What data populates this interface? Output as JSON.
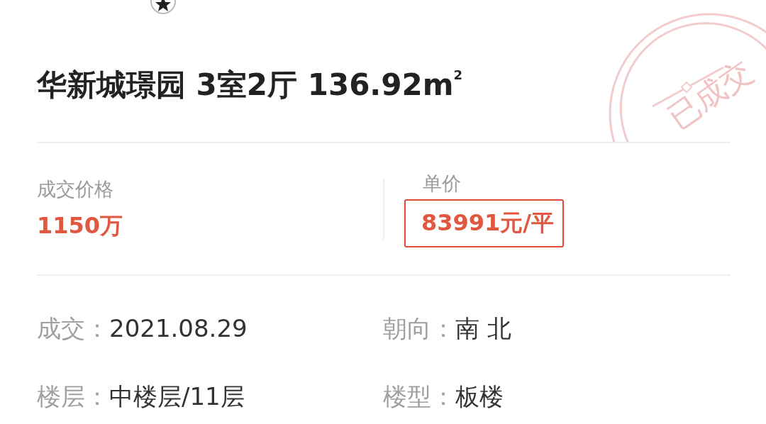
{
  "title": "华新城璟园 3室2厅 136.92m$^{2}$",
  "stamp": "已成交",
  "price": {
    "label": "成交价格",
    "value": "1150万"
  },
  "unit_price": {
    "label": "单价",
    "value": "83991元/平",
    "highlighted": true
  },
  "details": [
    {
      "label": "成交：",
      "value": "2021.08.29"
    },
    {
      "label": "朝向：",
      "value": "南 北"
    },
    {
      "label": "楼层：",
      "value": "中楼层/11层"
    },
    {
      "label": "楼型：",
      "value": "板楼"
    }
  ]
}
